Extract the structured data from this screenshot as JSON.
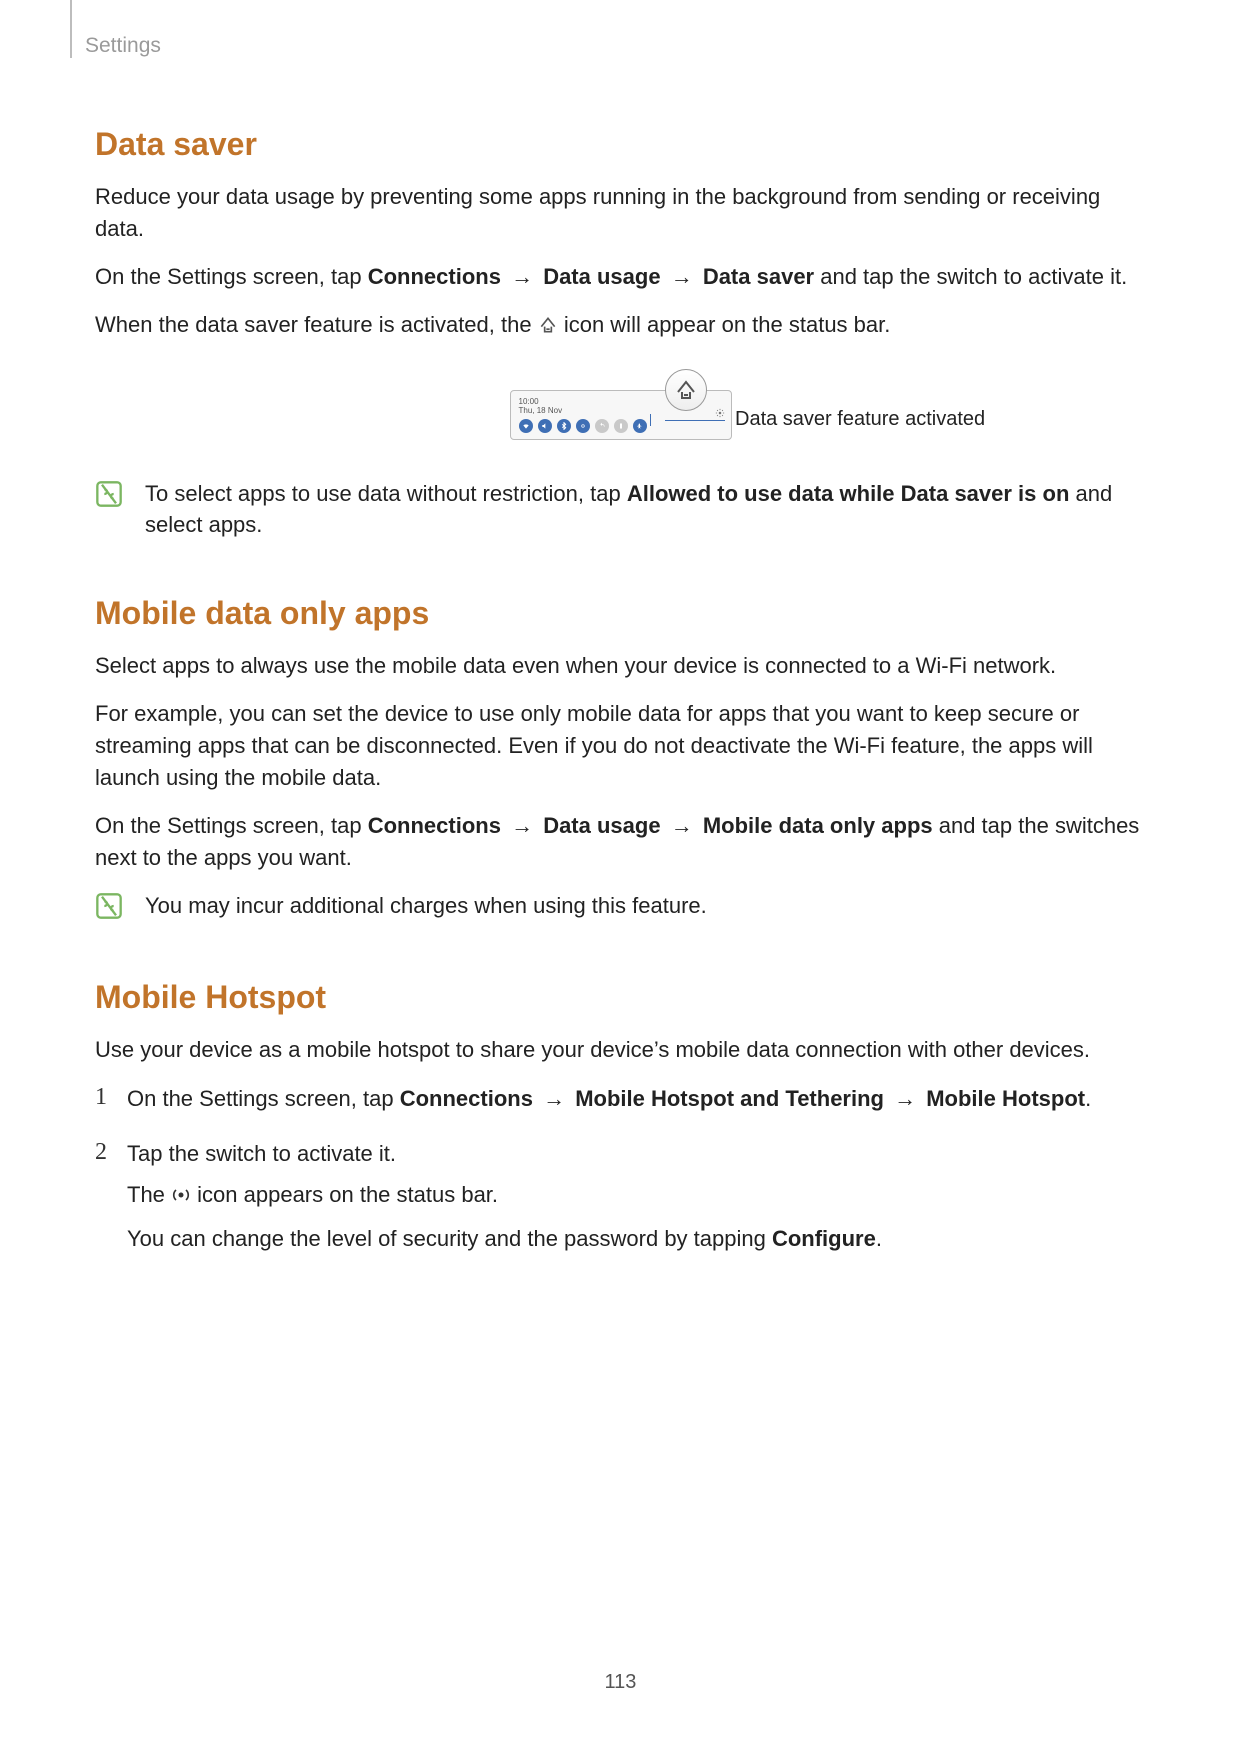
{
  "breadcrumb": "Settings",
  "page_number": "113",
  "section1": {
    "title": "Data saver",
    "p1": "Reduce your data usage by preventing some apps running in the background from sending or receiving data.",
    "p2_pre": "On the Settings screen, tap ",
    "p2_b1": "Connections",
    "p2_mid1": " → ",
    "p2_b2": "Data usage",
    "p2_mid2": " → ",
    "p2_b3": "Data saver",
    "p2_post": " and tap the switch to activate it.",
    "p3_pre": "When the data saver feature is activated, the ",
    "p3_post": " icon will appear on the status bar."
  },
  "figure": {
    "time": "10:00",
    "date": "Thu, 18 Nov",
    "callout": "Data saver feature activated"
  },
  "note1_pre": "To select apps to use data without restriction, tap ",
  "note1_bold": "Allowed to use data while Data saver is on",
  "note1_post": " and select apps.",
  "section2": {
    "title": "Mobile data only apps",
    "p1": "Select apps to always use the mobile data even when your device is connected to a Wi-Fi network.",
    "p2": "For example, you can set the device to use only mobile data for apps that you want to keep secure or streaming apps that can be disconnected. Even if you do not deactivate the Wi-Fi feature, the apps will launch using the mobile data.",
    "p3_pre": "On the Settings screen, tap ",
    "p3_b1": "Connections",
    "p3_mid1": " → ",
    "p3_b2": "Data usage",
    "p3_mid2": " → ",
    "p3_b3": "Mobile data only apps",
    "p3_post": " and tap the switches next to the apps you want."
  },
  "note2": "You may incur additional charges when using this feature.",
  "section3": {
    "title": "Mobile Hotspot",
    "p1": "Use your device as a mobile hotspot to share your device’s mobile data connection with other devices.",
    "step1_pre": "On the Settings screen, tap ",
    "step1_b1": "Connections",
    "step1_mid1": " → ",
    "step1_b2": "Mobile Hotspot and Tethering",
    "step1_mid2": " → ",
    "step1_b3": "Mobile Hotspot",
    "step1_post": ".",
    "step2_l1": "Tap the switch to activate it.",
    "step2_l2_pre": "The ",
    "step2_l2_post": " icon appears on the status bar.",
    "step2_l3_pre": "You can change the level of security and the password by tapping ",
    "step2_l3_b": "Configure",
    "step2_l3_post": "."
  },
  "nums": {
    "one": "1",
    "two": "2"
  }
}
